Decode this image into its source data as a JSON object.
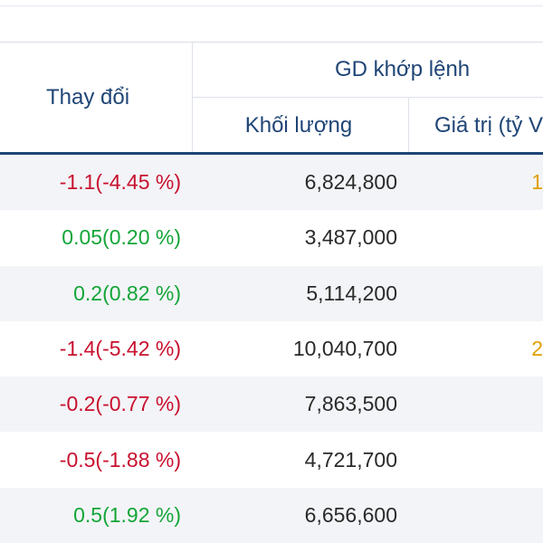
{
  "colors": {
    "header_text": "#1f4576",
    "header_rule": "#1f4576",
    "down": "#c8102e",
    "up": "#13a538",
    "stripe": "#f3f4f7",
    "value_text": "#2a2a2a"
  },
  "header": {
    "change": "Thay đổi",
    "group": "GD khớp lệnh",
    "volume": "Khối lượng",
    "value": "Giá trị (tỷ V"
  },
  "rows": [
    {
      "change": "-1.1(-4.45 %)",
      "direction": "down",
      "volume": "6,824,800",
      "value_fragment": "1"
    },
    {
      "change": "0.05(0.20 %)",
      "direction": "up",
      "volume": "3,487,000",
      "value_fragment": ""
    },
    {
      "change": "0.2(0.82 %)",
      "direction": "up",
      "volume": "5,114,200",
      "value_fragment": ""
    },
    {
      "change": "-1.4(-5.42 %)",
      "direction": "down",
      "volume": "10,040,700",
      "value_fragment": "2"
    },
    {
      "change": "-0.2(-0.77 %)",
      "direction": "down",
      "volume": "7,863,500",
      "value_fragment": ""
    },
    {
      "change": "-0.5(-1.88 %)",
      "direction": "down",
      "volume": "4,721,700",
      "value_fragment": ""
    },
    {
      "change": "0.5(1.92 %)",
      "direction": "up",
      "volume": "6,656,600",
      "value_fragment": ""
    }
  ]
}
